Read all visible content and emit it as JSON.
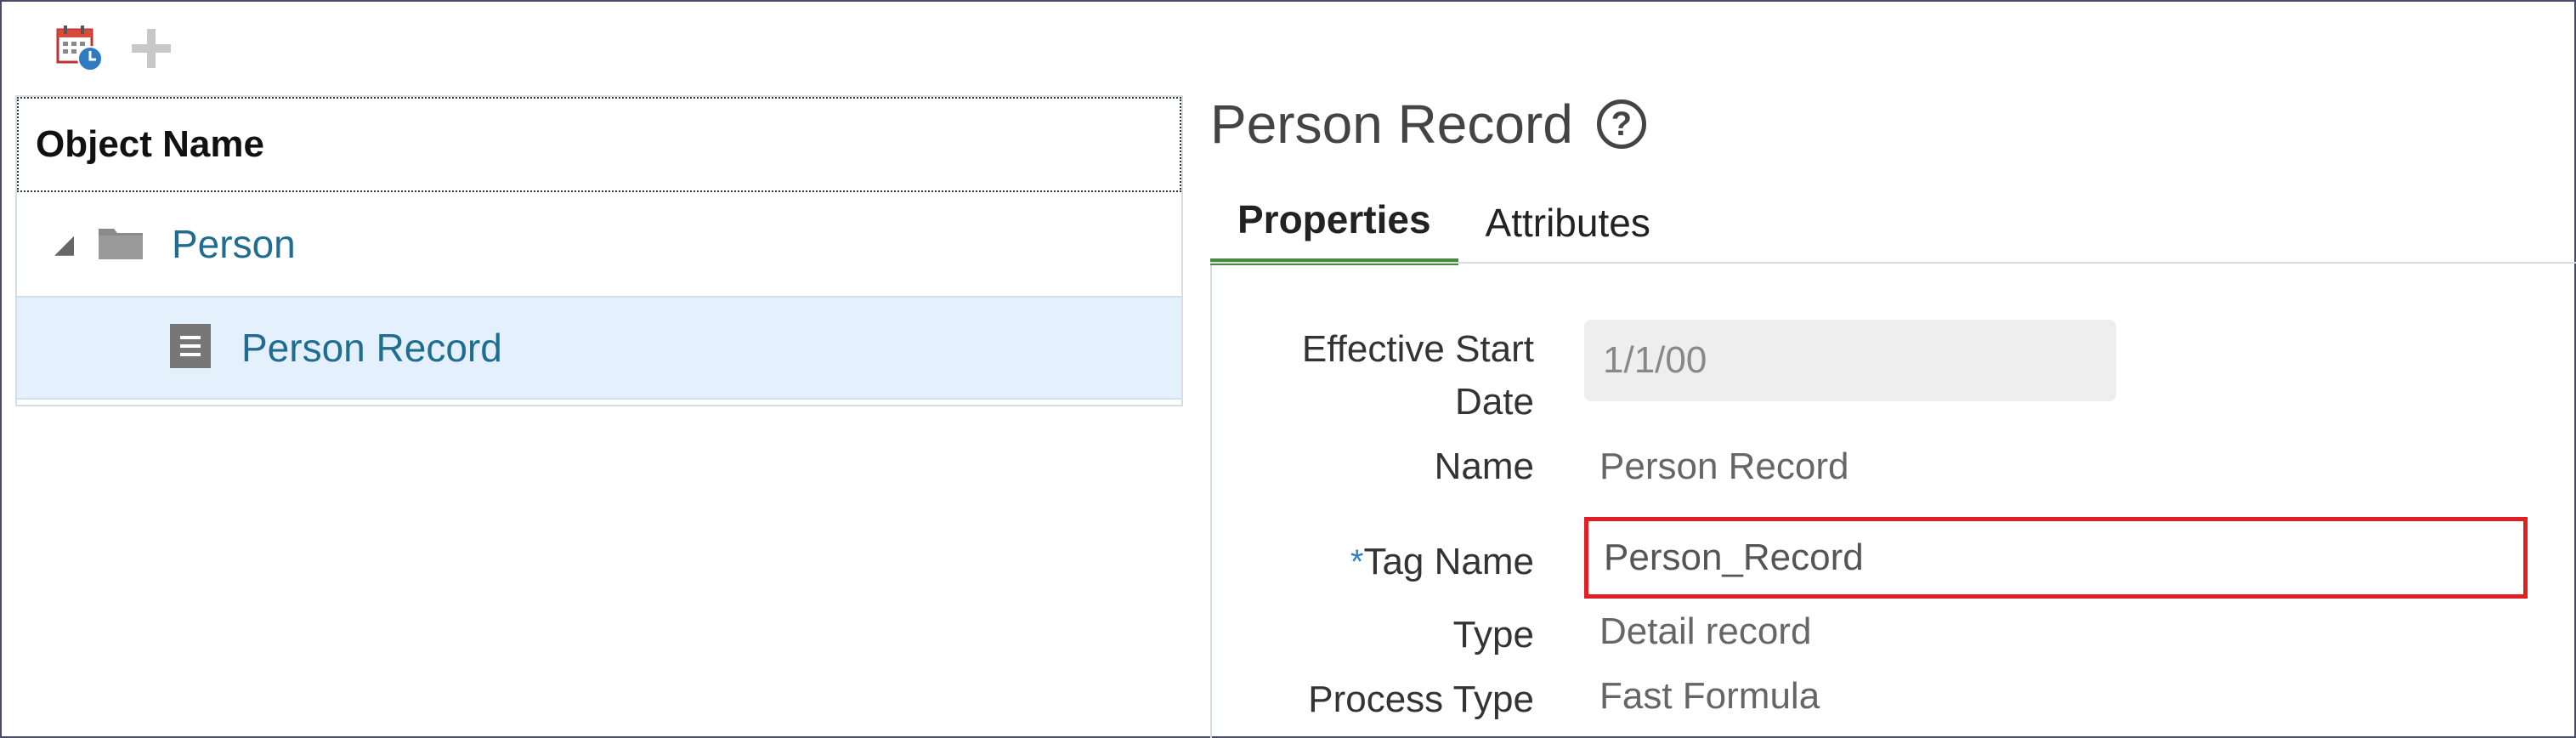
{
  "toolbar": {
    "calendar_icon": "calendar-clock-icon",
    "add_icon": "plus-icon"
  },
  "tree": {
    "header": "Object Name",
    "nodes": [
      {
        "label": "Person",
        "icon": "folder-icon",
        "expanded": true
      },
      {
        "label": "Person Record",
        "icon": "document-icon",
        "selected": true
      }
    ]
  },
  "detail": {
    "title": "Person Record",
    "help_icon": "help-icon",
    "tabs": [
      {
        "label": "Properties",
        "active": true
      },
      {
        "label": "Attributes",
        "active": false
      }
    ],
    "fields": {
      "effective_start_date": {
        "label_line1": "Effective Start",
        "label_line2": "Date",
        "value": "1/1/00"
      },
      "name": {
        "label": "Name",
        "value": "Person Record"
      },
      "tag_name": {
        "required_mark": "*",
        "label": "Tag Name",
        "value": "Person_Record"
      },
      "type": {
        "label": "Type",
        "value": "Detail record"
      },
      "process_type": {
        "label": "Process Type",
        "value": "Fast Formula"
      }
    }
  },
  "colors": {
    "link": "#1f6d91",
    "active_tab_underline": "#4b8a3e",
    "highlight_box": "#e01e24",
    "selected_row": "#e4f0fc"
  }
}
